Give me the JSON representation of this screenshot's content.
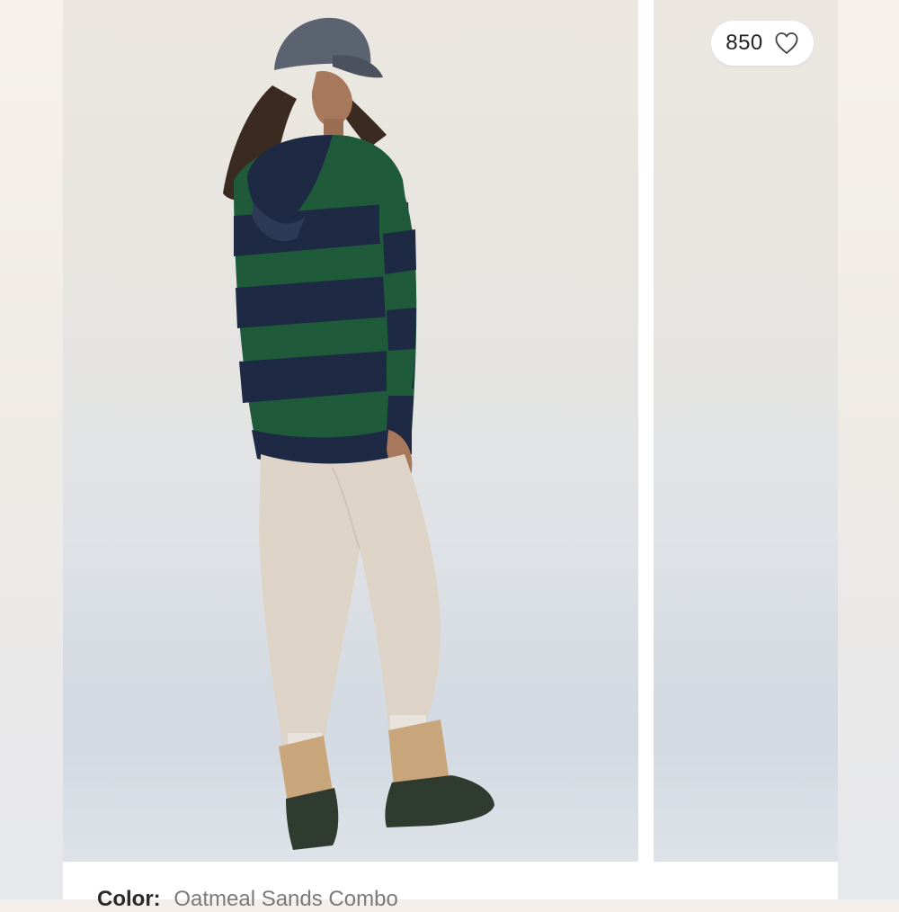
{
  "gallery": {
    "like_count": "850",
    "like_icon": "heart-outline-icon",
    "main_image_alt": "Model wearing green and navy striped hoodie, oatmeal joggers and duck boots",
    "secondary_image_alt": "Product image"
  },
  "product": {
    "color_label": "Color:",
    "color_value": "Oatmeal Sands Combo"
  },
  "colors": {
    "stripe_green": "#1f5a3a",
    "stripe_navy": "#1e2a44",
    "joggers": "#ddd3c6",
    "boot_tan": "#c8a57a",
    "boot_green": "#2f3b2e"
  }
}
